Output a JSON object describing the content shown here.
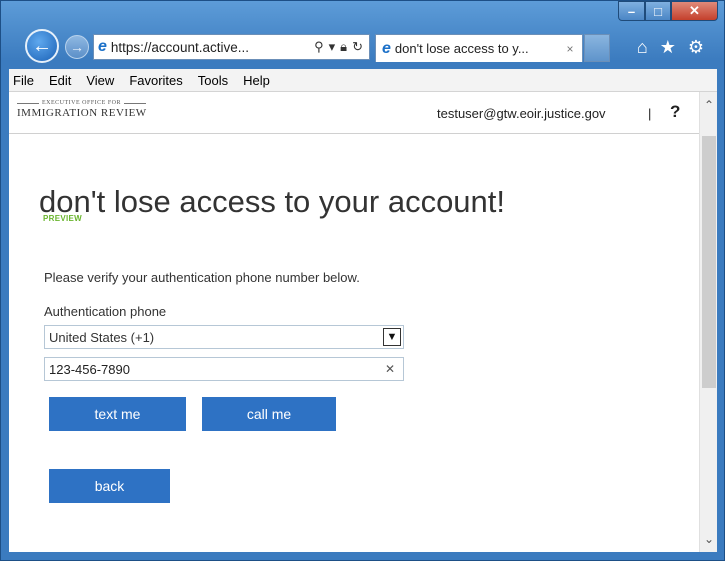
{
  "browser": {
    "address_url": "https://account.active...",
    "tab_title": "don't lose access to y...",
    "tab_close": "×",
    "menu": [
      "File",
      "Edit",
      "View",
      "Favorites",
      "Tools",
      "Help"
    ]
  },
  "header": {
    "logo_small": "EXECUTIVE OFFICE FOR",
    "logo_big": "IMMIGRATION REVIEW",
    "user": "testuser@gtw.eoir.justice.gov",
    "separator": "|",
    "help": "?"
  },
  "main": {
    "heading": "don't lose access to your account!",
    "preview_badge": "PREVIEW",
    "instruction": "Please verify your authentication phone number below.",
    "phone_label": "Authentication phone",
    "country_value": "United States (+1)",
    "phone_value": "123-456-7890",
    "text_button": "text me",
    "call_button": "call me",
    "back_button": "back"
  },
  "colors": {
    "button_blue": "#2e72c4",
    "preview_green": "#6ab52e",
    "frame_blue": "#3b7bbf"
  },
  "icons": [
    "back-arrow-icon",
    "forward-arrow-icon",
    "ie-logo-icon",
    "search-icon",
    "lock-icon",
    "refresh-icon",
    "home-icon",
    "favorites-star-icon",
    "gear-icon",
    "chevron-down-icon",
    "clear-icon"
  ]
}
